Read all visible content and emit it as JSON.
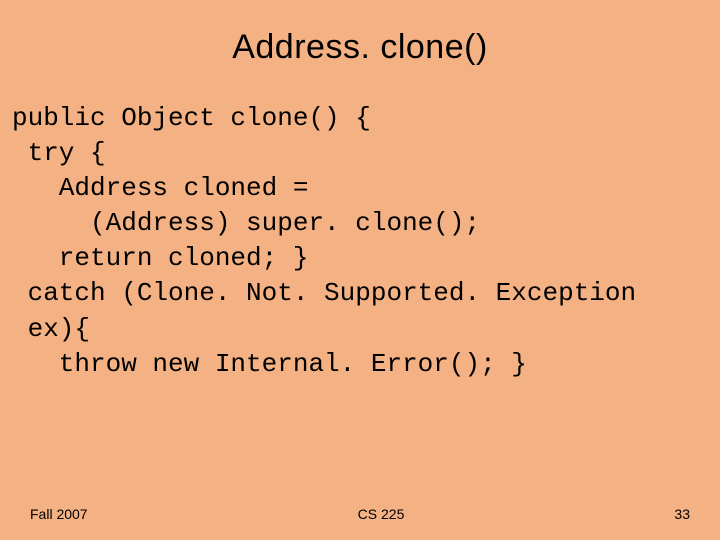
{
  "title": "Address. clone()",
  "code": "public Object clone() {\n try {\n   Address cloned =\n     (Address) super. clone();\n   return cloned; }\n catch (Clone. Not. Supported. Exception\n ex){\n   throw new Internal. Error(); }",
  "footer": {
    "left": "Fall 2007",
    "center": "CS 225",
    "right": "33"
  }
}
